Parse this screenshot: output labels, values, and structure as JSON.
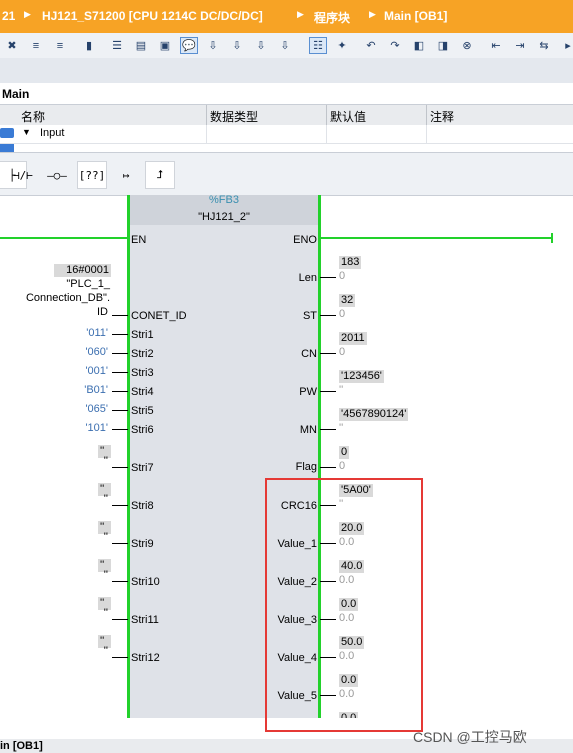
{
  "breadcrumb": {
    "items": [
      "21",
      "HJ121_S71200 [CPU 1214C DC/DC/DC]",
      "程序块",
      "Main [OB1]"
    ]
  },
  "interface": {
    "title": "Main",
    "columns": [
      "名称",
      "数据类型",
      "默认值",
      "注释"
    ],
    "row_input": "Input"
  },
  "block": {
    "type_label": "%FB3",
    "instance_name": "\"HJ121_2\"",
    "en": "EN",
    "eno": "ENO"
  },
  "inputs": [
    {
      "pin": "CONET_ID",
      "value_line1": "16#0001",
      "value_line2": "\"PLC_1_",
      "value_line3": "Connection_DB\".",
      "value_line4": "ID"
    },
    {
      "pin": "Stri1",
      "value": "'011'"
    },
    {
      "pin": "Stri2",
      "value": "'060'"
    },
    {
      "pin": "Stri3",
      "value": "'001'"
    },
    {
      "pin": "Stri4",
      "value": "'B01'"
    },
    {
      "pin": "Stri5",
      "value": "'065'"
    },
    {
      "pin": "Stri6",
      "value": "'101'"
    },
    {
      "pin": "Stri7",
      "value": "''"
    },
    {
      "pin": "Stri8",
      "value": "''"
    },
    {
      "pin": "Stri9",
      "value": "''"
    },
    {
      "pin": "Stri10",
      "value": "''"
    },
    {
      "pin": "Stri11",
      "value": "''"
    },
    {
      "pin": "Stri12",
      "value": "''"
    }
  ],
  "outputs": [
    {
      "pin": "Len",
      "monitor": "183",
      "value": "0"
    },
    {
      "pin": "ST",
      "monitor": "32",
      "value": "0"
    },
    {
      "pin": "CN",
      "monitor": "2011",
      "value": "0"
    },
    {
      "pin": "PW",
      "monitor": "'123456'",
      "value": "''"
    },
    {
      "pin": "MN",
      "monitor": "'4567890124'",
      "value": "''"
    },
    {
      "pin": "Flag",
      "monitor": "0",
      "value": "0"
    },
    {
      "pin": "CRC16",
      "monitor": "'5A00'",
      "value": "''"
    },
    {
      "pin": "Value_1",
      "monitor": "20.0",
      "value": "0.0"
    },
    {
      "pin": "Value_2",
      "monitor": "40.0",
      "value": "0.0"
    },
    {
      "pin": "Value_3",
      "monitor": "0.0",
      "value": "0.0"
    },
    {
      "pin": "Value_4",
      "monitor": "50.0",
      "value": "0.0"
    },
    {
      "pin": "Value_5",
      "monitor": "0.0",
      "value": "0.0"
    },
    {
      "pin": "",
      "monitor": "0.0",
      "value": ""
    }
  ],
  "bottom_tab": "in [OB1]",
  "watermark": "CSDN @工控马欧",
  "colors": {
    "accent": "#f7a325",
    "rail": "#22d12b",
    "highlight": "#e53935"
  }
}
